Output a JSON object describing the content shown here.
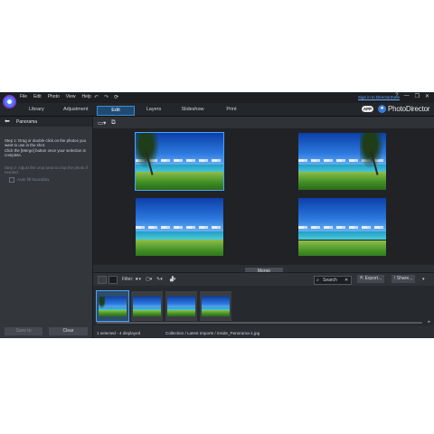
{
  "menu": [
    "File",
    "Edit",
    "Photo",
    "View",
    "Help"
  ],
  "titlebar": {
    "undo_icon": "undo-icon",
    "redo_icon": "redo-icon",
    "refresh_icon": "refresh-icon",
    "sign_in": "Sign in to DirectorZone",
    "controls": [
      "?",
      "—",
      "❐",
      "✕"
    ]
  },
  "tabs": {
    "library": "Library",
    "adjustment": "Adjustment",
    "edit": "Edit",
    "layers": "Layers",
    "slideshow": "Slideshow",
    "print": "Print"
  },
  "brand": {
    "app_badge": "APP",
    "name": "PhotoDirector"
  },
  "left_panel": {
    "title": "Panorama",
    "step1": "Step 1: Drag or double click on the photos you want to use in the shot.",
    "step1b": "Click the [Merge] button once your selection is complete.",
    "step2": "Step 2: Adjust the crop area to crop the photo if needed.",
    "auto_fill": "Auto fill boundary",
    "save_to": "Save to",
    "clear": "Clear"
  },
  "preview": {
    "merge": "Merge"
  },
  "filmstrip_tools": {
    "filter_label": "Filter:",
    "search": "Search",
    "export": "Export...",
    "share": "Share..."
  },
  "status": {
    "selection": "1 selected - 4 displayed",
    "path": "Collection / Latest Imports / inside_Panorama-1.jpg"
  }
}
